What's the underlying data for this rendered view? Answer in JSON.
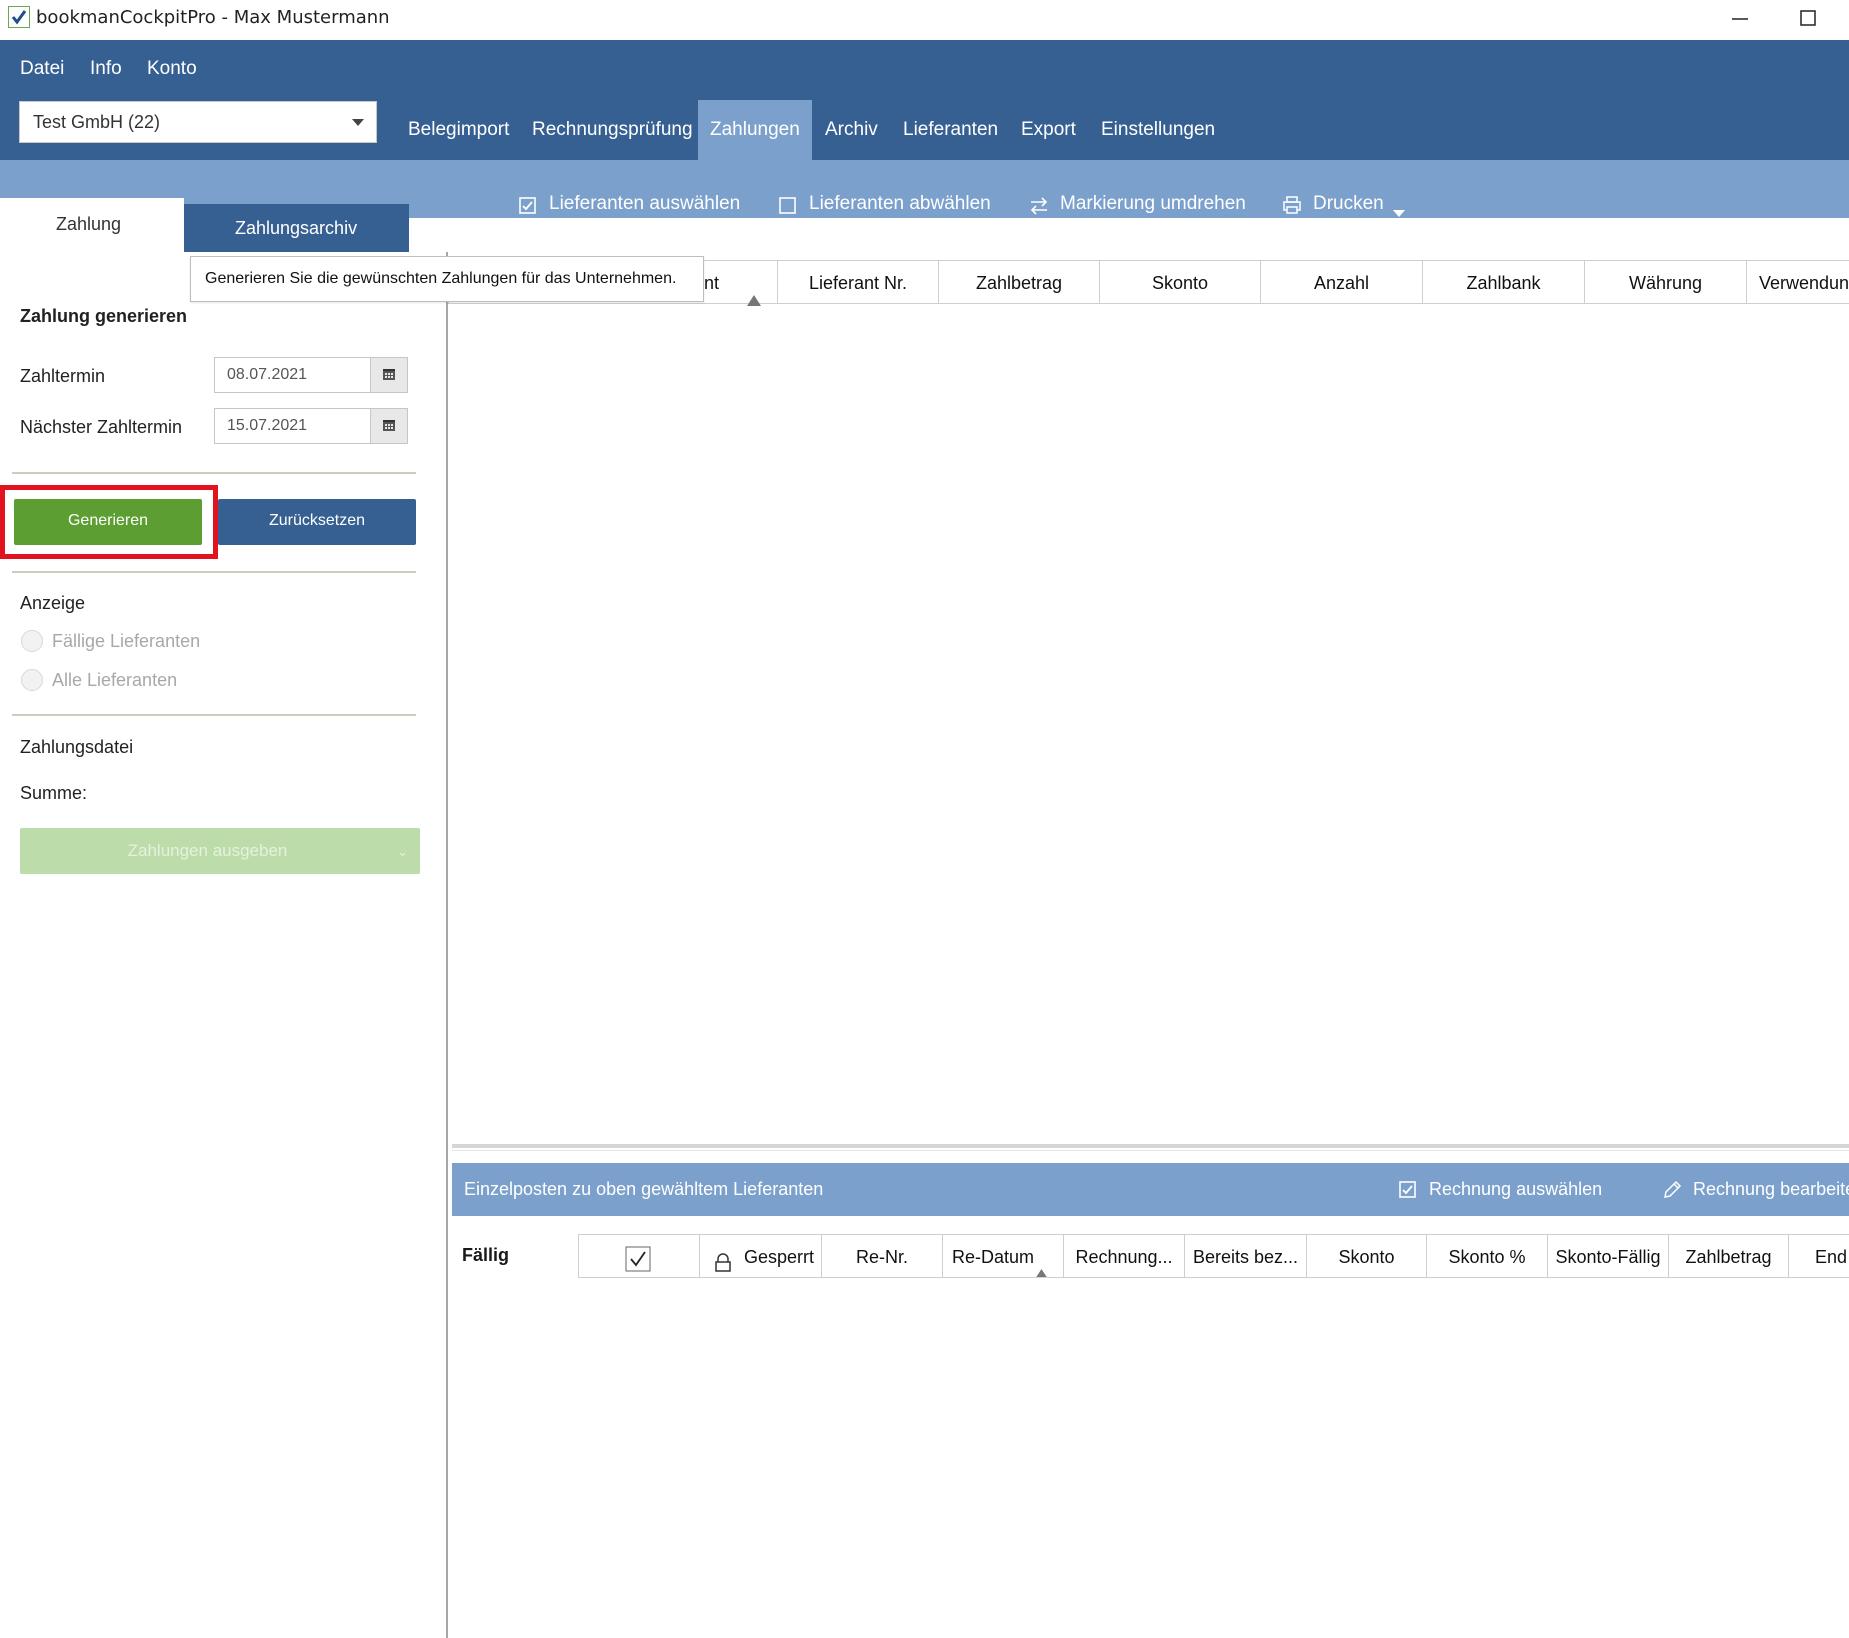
{
  "window": {
    "title": "bookmanCockpitPro - Max  Mustermann"
  },
  "menu": {
    "items": [
      "Datei",
      "Info",
      "Konto"
    ]
  },
  "company_select": {
    "value": "Test GmbH (22)"
  },
  "nav": {
    "tabs": [
      "Belegimport",
      "Rechnungsprüfung",
      "Zahlungen",
      "Archiv",
      "Lieferanten",
      "Export",
      "Einstellungen"
    ],
    "active": "Zahlungen"
  },
  "toolbar": {
    "select_suppliers": "Lieferanten auswählen",
    "deselect_suppliers": "Lieferanten abwählen",
    "invert_selection": "Markierung umdrehen",
    "print": "Drucken"
  },
  "left_tabs": {
    "payment": "Zahlung",
    "archive": "Zahlungsarchiv"
  },
  "tooltip": "Generieren Sie die gewünschten Zahlungen für das Unternehmen.",
  "panel": {
    "heading": "Zahlung generieren",
    "payment_date_label": "Zahltermin",
    "payment_date_value": "08.07.2021",
    "next_payment_date_label": "Nächster Zahltermin",
    "next_payment_date_value": "15.07.2021",
    "generate_button": "Generieren",
    "reset_button": "Zurücksetzen",
    "display_label": "Anzeige",
    "radio_due": "Fällige Lieferanten",
    "radio_all": "Alle Lieferanten",
    "payment_file_label": "Zahlungsdatei",
    "sum_label": "Summe:",
    "output_button": "Zahlungen ausgeben"
  },
  "upper_grid": {
    "columns": [
      "Lieferant",
      "Lieferant Nr.",
      "Zahlbetrag",
      "Skonto",
      "Anzahl",
      "Zahlbank",
      "Währung",
      "Verwendun"
    ],
    "visible_first": "nt"
  },
  "lower": {
    "title": "Einzelposten zu oben gewähltem Lieferanten",
    "select_invoice": "Rechnung auswählen",
    "edit_invoice": "Rechnung bearbeite",
    "due_label": "Fällig",
    "columns": [
      "Gesperrt",
      "Re-Nr.",
      "Re-Datum",
      "Rechnung...",
      "Bereits bez...",
      "Skonto",
      "Skonto %",
      "Skonto-Fällig",
      "Zahlbetrag",
      "End"
    ]
  },
  "colors": {
    "header": "#376092",
    "subbar": "#7ba0cc",
    "generate": "#5c9e32",
    "highlight": "#e3121f"
  }
}
